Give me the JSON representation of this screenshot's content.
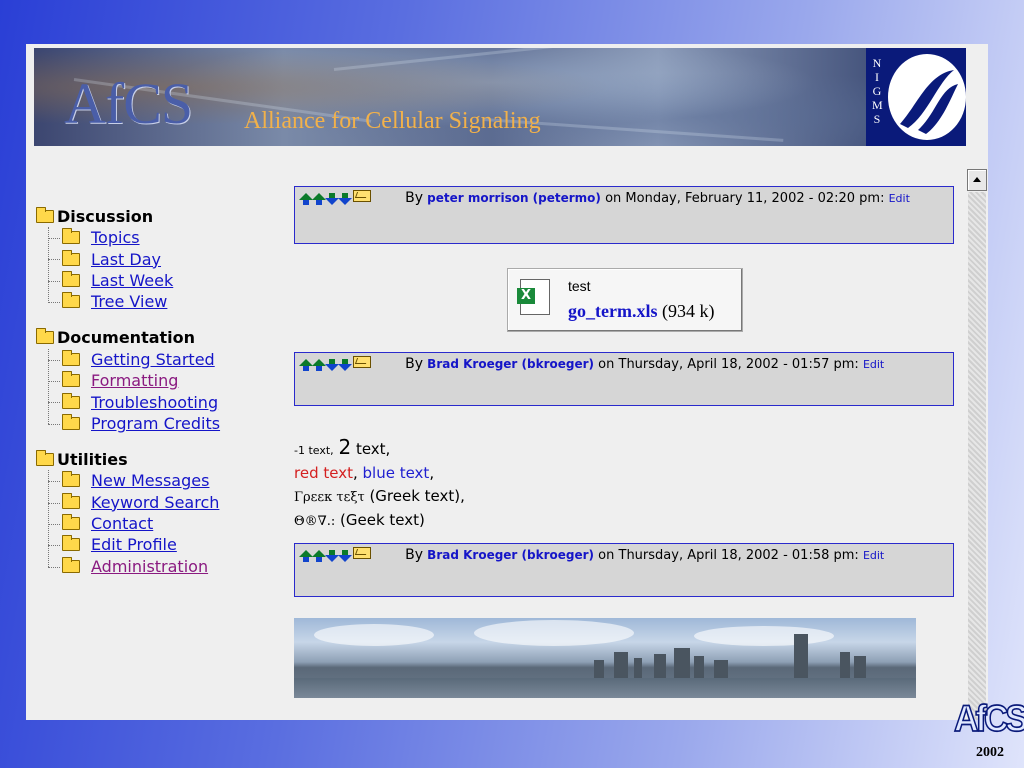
{
  "banner": {
    "logo": "AfCS",
    "title": "Alliance for Cellular Signaling",
    "nigms_letters": [
      "N",
      "I",
      "G",
      "M",
      "S"
    ]
  },
  "nav": {
    "sections": [
      {
        "title": "Discussion",
        "items": [
          {
            "label": "Topics",
            "visited": false
          },
          {
            "label": "Last Day",
            "visited": false
          },
          {
            "label": "Last Week",
            "visited": false
          },
          {
            "label": "Tree View",
            "visited": false
          }
        ]
      },
      {
        "title": "Documentation",
        "items": [
          {
            "label": "Getting Started",
            "visited": false
          },
          {
            "label": "Formatting",
            "visited": true
          },
          {
            "label": "Troubleshooting",
            "visited": false
          },
          {
            "label": "Program Credits",
            "visited": false
          }
        ]
      },
      {
        "title": "Utilities",
        "items": [
          {
            "label": "New Messages",
            "visited": false
          },
          {
            "label": "Keyword Search",
            "visited": false
          },
          {
            "label": "Contact",
            "visited": false
          },
          {
            "label": "Edit Profile",
            "visited": false
          },
          {
            "label": "Administration",
            "visited": true
          }
        ]
      }
    ]
  },
  "messages": [
    {
      "by": "By",
      "author": "peter morrison (petermo)",
      "on": "on",
      "date": "Monday, February 11, 2002 - 02:20 pm:",
      "edit": "Edit"
    },
    {
      "by": "By",
      "author": "Brad Kroeger (bkroeger)",
      "on": "on",
      "date": "Thursday, April 18, 2002 - 01:57 pm:",
      "edit": "Edit"
    },
    {
      "by": "By",
      "author": "Brad Kroeger (bkroeger)",
      "on": "on",
      "date": "Thursday, April 18, 2002 - 01:58 pm:",
      "edit": "Edit"
    }
  ],
  "attachment": {
    "name": "test",
    "file": "go_term.xls",
    "size": "(934 k)"
  },
  "formatting_sample": {
    "small": "-1 text,",
    "big": "2",
    "big_rest": " text,",
    "red": "red text",
    "sep1": ", ",
    "blue": "blue text",
    "sep2": ",",
    "greek_glyphs": "Γρεεκ τεξτ",
    "greek_rest": " (Greek text),",
    "geek_glyphs": "Θ®∇.:",
    "geek_rest": "  (Geek text)"
  },
  "footer": {
    "logo": "AfCS",
    "year": "2002"
  },
  "colors": {
    "link": "#1515c8",
    "visited": "#8a1a80",
    "red": "#d42020",
    "bar_border": "#2a2acc",
    "nigms_bg": "#0a1a7a",
    "title": "#f2b14a"
  }
}
